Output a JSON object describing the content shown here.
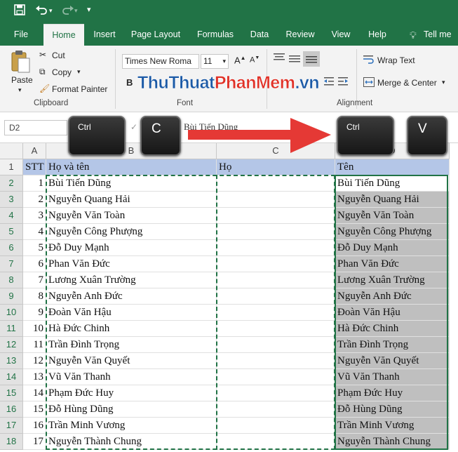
{
  "quick_access": {
    "save_icon": "save-icon",
    "undo_icon": "undo-icon",
    "redo_icon": "redo-icon",
    "customize_icon": "customize-icon"
  },
  "tabs": [
    "File",
    "Home",
    "Insert",
    "Page Layout",
    "Formulas",
    "Data",
    "Review",
    "View",
    "Help",
    "Tell me w"
  ],
  "ribbon": {
    "clipboard": {
      "label": "Clipboard",
      "paste": "Paste",
      "cut": "Cut",
      "copy": "Copy",
      "format_painter": "Format Painter"
    },
    "font": {
      "label": "Font",
      "font_name": "Times New Roma",
      "font_size": "11",
      "bold": "B"
    },
    "alignment": {
      "label": "Alignment",
      "wrap_text": "Wrap Text",
      "merge_center": "Merge & Center"
    }
  },
  "watermark": {
    "part1": "ThuThuat",
    "part2": "PhanMem",
    "part3": ".vn"
  },
  "formula_bar": {
    "name_box": "D2",
    "formula": "Bùi Tiến Dũng"
  },
  "keys": {
    "ctrl": "Ctrl",
    "c": "C",
    "v": "V"
  },
  "columns": [
    "A",
    "B",
    "C",
    "D"
  ],
  "headers": {
    "stt": "STT",
    "full_name": "Họ và tên",
    "last_name": "Họ",
    "first_name": "Tên"
  },
  "rows": [
    {
      "row": "2",
      "stt": "1",
      "name": "Bùi Tiến Dũng",
      "copy": "Bùi Tiến Dũng"
    },
    {
      "row": "3",
      "stt": "2",
      "name": "Nguyễn Quang Hải",
      "copy": "Nguyễn Quang Hải"
    },
    {
      "row": "4",
      "stt": "3",
      "name": "Nguyễn Văn Toàn",
      "copy": "Nguyễn Văn Toàn"
    },
    {
      "row": "5",
      "stt": "4",
      "name": "Nguyễn Công Phượng",
      "copy": "Nguyễn Công Phượng"
    },
    {
      "row": "6",
      "stt": "5",
      "name": "Đỗ Duy Mạnh",
      "copy": "Đỗ Duy Mạnh"
    },
    {
      "row": "7",
      "stt": "6",
      "name": "Phan Văn Đức",
      "copy": "Phan Văn Đức"
    },
    {
      "row": "8",
      "stt": "7",
      "name": "Lương Xuân Trường",
      "copy": "Lương Xuân Trường"
    },
    {
      "row": "9",
      "stt": "8",
      "name": "Nguyễn Anh Đức",
      "copy": "Nguyễn Anh Đức"
    },
    {
      "row": "10",
      "stt": "9",
      "name": "Đoàn Văn Hậu",
      "copy": "Đoàn Văn Hậu"
    },
    {
      "row": "11",
      "stt": "10",
      "name": "Hà Đức Chinh",
      "copy": "Hà Đức Chinh"
    },
    {
      "row": "12",
      "stt": "11",
      "name": "Trần Đình Trọng",
      "copy": "Trần Đình Trọng"
    },
    {
      "row": "13",
      "stt": "12",
      "name": "Nguyễn Văn Quyết",
      "copy": "Nguyễn Văn Quyết"
    },
    {
      "row": "14",
      "stt": "13",
      "name": "Vũ Văn Thanh",
      "copy": "Vũ Văn Thanh"
    },
    {
      "row": "15",
      "stt": "14",
      "name": "Phạm Đức Huy",
      "copy": "Phạm Đức Huy"
    },
    {
      "row": "16",
      "stt": "15",
      "name": "Đỗ Hùng Dũng",
      "copy": "Đỗ Hùng Dũng"
    },
    {
      "row": "17",
      "stt": "16",
      "name": "Trần Minh Vương",
      "copy": "Trần Minh Vương"
    },
    {
      "row": "18",
      "stt": "17",
      "name": "Nguyễn Thành Chung",
      "copy": "Nguyễn Thành Chung"
    }
  ],
  "header_row": "1",
  "colors": {
    "excel_green": "#217346",
    "header_fill": "#b4c6e7",
    "paste_fill": "#bfbfbf",
    "arrow": "#e53935"
  }
}
